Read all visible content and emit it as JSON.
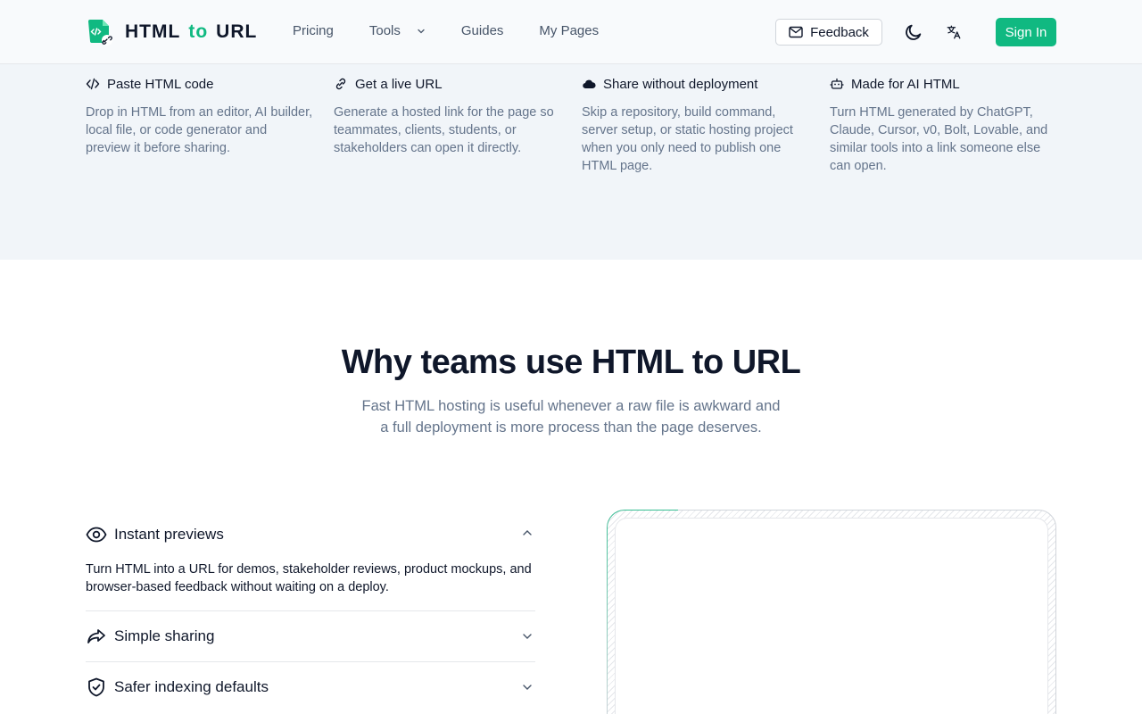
{
  "header": {
    "logo": {
      "part1": "HTML",
      "part2": "to",
      "part3": "URL"
    },
    "nav": [
      {
        "label": "Pricing"
      },
      {
        "label": "Tools"
      },
      {
        "label": "Guides"
      },
      {
        "label": "My Pages"
      }
    ],
    "feedback_label": "Feedback",
    "signin_label": "Sign In"
  },
  "features": [
    {
      "icon": "code-icon",
      "title": "Paste HTML code",
      "desc": "Drop in HTML from an editor, AI builder, local file, or code generator and preview it before sharing."
    },
    {
      "icon": "link-icon",
      "title": "Get a live URL",
      "desc": "Generate a hosted link for the page so teammates, clients, students, or stakeholders can open it directly."
    },
    {
      "icon": "cloud-icon",
      "title": "Share without deployment",
      "desc": "Skip a repository, build command, server setup, or static hosting project when you only need to publish one HTML page."
    },
    {
      "icon": "bot-icon",
      "title": "Made for AI HTML",
      "desc": "Turn HTML generated by ChatGPT, Claude, Cursor, v0, Bolt, Lovable, and similar tools into a link someone else can open."
    }
  ],
  "why": {
    "title": "Why teams use HTML to URL",
    "subtitle": "Fast HTML hosting is useful whenever a raw file is awkward and a full deployment is more process than the page deserves."
  },
  "accordion": [
    {
      "icon": "eye-icon",
      "label": "Instant previews",
      "expanded": true,
      "body": "Turn HTML into a URL for demos, stakeholder reviews, product mockups, and browser-based feedback without waiting on a deploy."
    },
    {
      "icon": "share-icon",
      "label": "Simple sharing",
      "expanded": false
    },
    {
      "icon": "shield-check-icon",
      "label": "Safer indexing defaults",
      "expanded": false
    }
  ],
  "colors": {
    "accent": "#10b981",
    "text": "#0f172a",
    "muted": "#64748b",
    "band": "#f1f5f9"
  }
}
